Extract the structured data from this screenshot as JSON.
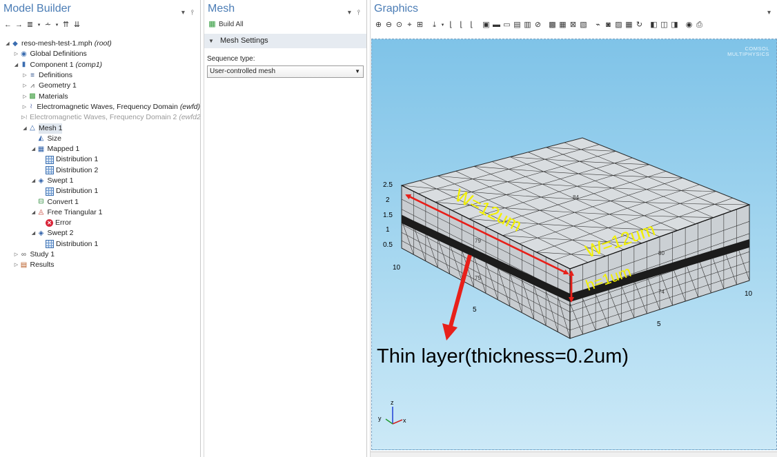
{
  "model_builder": {
    "title": "Model Builder",
    "tree": [
      {
        "label": "reso-mesh-test-1.mph",
        "tag": "(root)",
        "level": 0,
        "toggle": "open",
        "icon": "root-icon"
      },
      {
        "label": "Global Definitions",
        "tag": "",
        "level": 1,
        "toggle": "closed",
        "icon": "global-definitions-icon"
      },
      {
        "label": "Component 1",
        "tag": "(comp1)",
        "level": 1,
        "toggle": "open",
        "icon": "component-icon"
      },
      {
        "label": "Definitions",
        "tag": "",
        "level": 2,
        "toggle": "closed",
        "icon": "definitions-icon"
      },
      {
        "label": "Geometry 1",
        "tag": "",
        "level": 2,
        "toggle": "closed",
        "icon": "geometry-icon"
      },
      {
        "label": "Materials",
        "tag": "",
        "level": 2,
        "toggle": "closed",
        "icon": "materials-icon"
      },
      {
        "label": "Electromagnetic Waves, Frequency Domain",
        "tag": "(ewfd)",
        "level": 2,
        "toggle": "closed",
        "icon": "physics-icon"
      },
      {
        "label": "Electromagnetic Waves, Frequency Domain 2",
        "tag": "(ewfd2)",
        "level": 2,
        "toggle": "closed",
        "icon": "physics-icon",
        "disabled": true
      },
      {
        "label": "Mesh 1",
        "tag": "",
        "level": 2,
        "toggle": "open",
        "icon": "mesh-icon",
        "selected": true
      },
      {
        "label": "Size",
        "tag": "",
        "level": 3,
        "toggle": "",
        "icon": "size-icon"
      },
      {
        "label": "Mapped 1",
        "tag": "",
        "level": 3,
        "toggle": "open",
        "icon": "mapped-icon"
      },
      {
        "label": "Distribution 1",
        "tag": "",
        "level": 4,
        "toggle": "",
        "icon": "distribution-icon"
      },
      {
        "label": "Distribution 2",
        "tag": "",
        "level": 4,
        "toggle": "",
        "icon": "distribution-icon"
      },
      {
        "label": "Swept 1",
        "tag": "",
        "level": 3,
        "toggle": "open",
        "icon": "swept-icon"
      },
      {
        "label": "Distribution 1",
        "tag": "",
        "level": 4,
        "toggle": "",
        "icon": "distribution-icon"
      },
      {
        "label": "Convert 1",
        "tag": "",
        "level": 3,
        "toggle": "",
        "icon": "convert-icon"
      },
      {
        "label": "Free Triangular 1",
        "tag": "",
        "level": 3,
        "toggle": "open",
        "icon": "free-triangular-icon"
      },
      {
        "label": "Error",
        "tag": "",
        "level": 4,
        "toggle": "",
        "icon": "error-icon"
      },
      {
        "label": "Swept 2",
        "tag": "",
        "level": 3,
        "toggle": "open",
        "icon": "swept-icon"
      },
      {
        "label": "Distribution 1",
        "tag": "",
        "level": 4,
        "toggle": "",
        "icon": "distribution-icon"
      },
      {
        "label": "Study 1",
        "tag": "",
        "level": 1,
        "toggle": "closed",
        "icon": "study-icon"
      },
      {
        "label": "Results",
        "tag": "",
        "level": 1,
        "toggle": "closed",
        "icon": "results-icon"
      }
    ]
  },
  "mesh_panel": {
    "title": "Mesh",
    "build_all": "Build All",
    "section": "Mesh Settings",
    "sequence_label": "Sequence type:",
    "sequence_value": "User-controlled mesh"
  },
  "graphics": {
    "title": "Graphics",
    "logo_line1": "COMSOL",
    "logo_line2": "MULTIPHYSICS",
    "z_ticks": [
      "2.5",
      "2",
      "1.5",
      "1",
      "0.5"
    ],
    "axis_numbers": {
      "left_10": "10",
      "left_5": "5",
      "right_10": "10",
      "right_5": "5"
    },
    "mesh_numbers": [
      "84",
      "79",
      "75",
      "80",
      "74"
    ],
    "annotations": {
      "w_left": "W=12um",
      "w_right": "W=12um",
      "h": "h=1um",
      "thin_layer": "Thin layer(thickness=0.2um)"
    },
    "triad": {
      "x": "x",
      "y": "y",
      "z": "z"
    },
    "annotation_colors": {
      "yellow": "#f2f000",
      "red": "#e8201a"
    }
  }
}
